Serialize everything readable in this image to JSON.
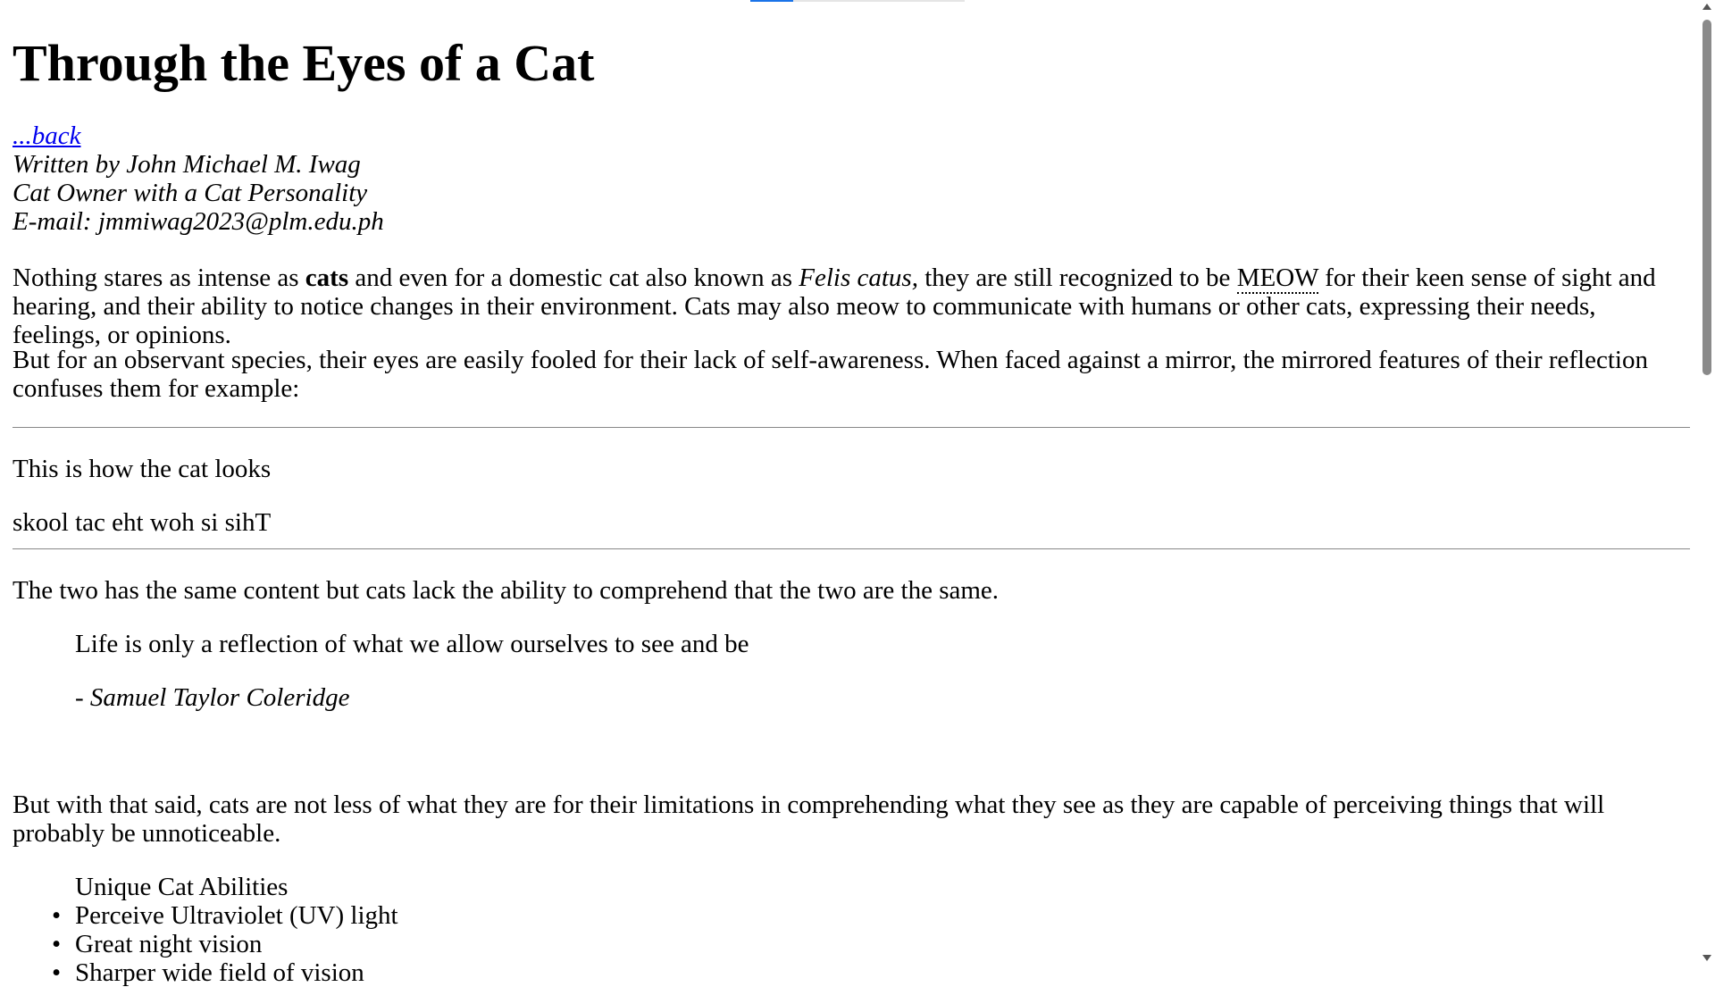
{
  "title": "Through the Eyes of a Cat",
  "byline": {
    "back_link": "...back",
    "author": "Written by John Michael M. Iwag",
    "role": "Cat Owner with a Cat Personality",
    "email": "E-mail: jmmiwag2023@plm.edu.ph"
  },
  "intro": {
    "part1": "Nothing stares as intense as ",
    "bold": "cats",
    "part2": " and even for a domestic cat also known as ",
    "italic": "Felis catus,",
    "part3": " they are still recognized to be ",
    "abbr": "MEOW",
    "part4": " for their keen sense of sight and hearing, and their ability to notice changes in their environment. Cats may also meow to communicate with humans or other cats, expressing their needs, feelings, or opinions."
  },
  "mirror_intro": "But for an observant species, their eyes are easily fooled for their lack of self-awareness. When faced against a mirror, the mirrored features of their reflection confuses them for example:",
  "example": {
    "normal": "This is how the cat looks",
    "mirrored": "skool tac eht woh si sihT"
  },
  "comparison": "The two has the same content but cats lack the ability to comprehend that the two are the same.",
  "quote": {
    "text": "Life is only a reflection of what we allow ourselves to see and be",
    "author": "- Samuel Taylor Coleridge"
  },
  "conclusion": "But with that said, cats are not less of what they are for their limitations in comprehending what they see as they are capable of perceiving things that will probably be unnoticeable.",
  "abilities": {
    "caption": "Unique Cat Abilities",
    "items": [
      "Perceive Ultraviolet (UV) light",
      "Great night vision",
      "Sharper wide field of vision"
    ]
  }
}
